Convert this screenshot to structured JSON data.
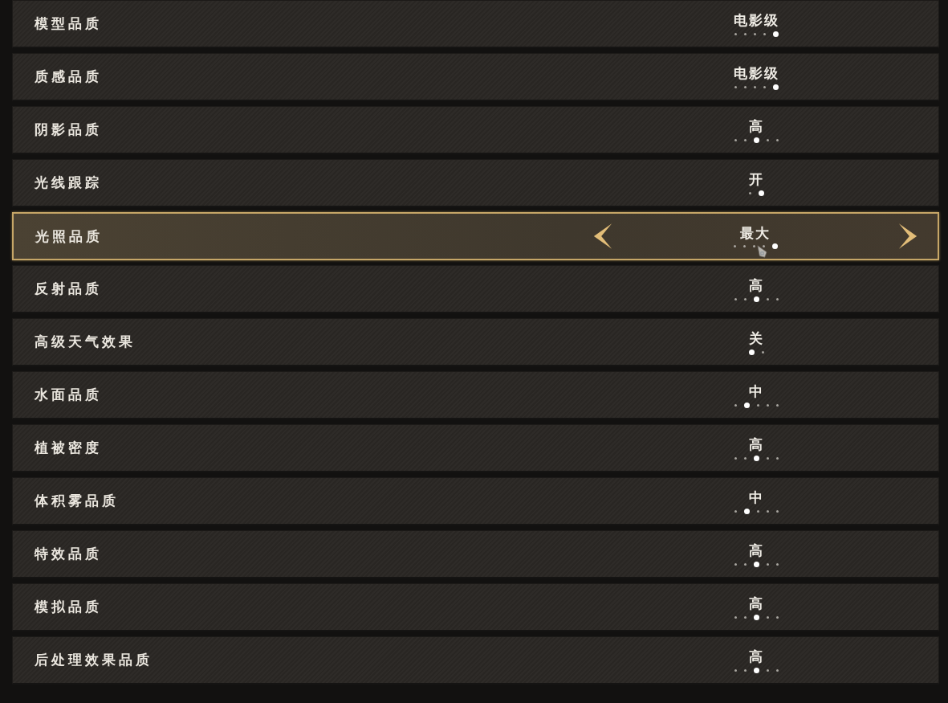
{
  "settings": [
    {
      "label": "模型品质",
      "value": "电影级",
      "selected": false,
      "steps": [
        {
          "selected": false
        },
        {
          "selected": false
        },
        {
          "selected": false
        },
        {
          "selected": false
        },
        {
          "selected": true
        }
      ]
    },
    {
      "label": "质感品质",
      "value": "电影级",
      "selected": false,
      "steps": [
        {
          "selected": false
        },
        {
          "selected": false
        },
        {
          "selected": false
        },
        {
          "selected": false
        },
        {
          "selected": true
        }
      ]
    },
    {
      "label": "阴影品质",
      "value": "高",
      "selected": false,
      "steps": [
        {
          "selected": false
        },
        {
          "selected": false
        },
        {
          "selected": true
        },
        {
          "selected": false
        },
        {
          "selected": false
        }
      ]
    },
    {
      "label": "光线跟踪",
      "value": "开",
      "selected": false,
      "steps": [
        {
          "selected": false
        },
        {
          "selected": true
        }
      ]
    },
    {
      "label": "光照品质",
      "value": "最大",
      "selected": true,
      "steps": [
        {
          "selected": false
        },
        {
          "selected": false
        },
        {
          "selected": false
        },
        {
          "selected": false
        },
        {
          "selected": true
        }
      ]
    },
    {
      "label": "反射品质",
      "value": "高",
      "selected": false,
      "steps": [
        {
          "selected": false
        },
        {
          "selected": false
        },
        {
          "selected": true
        },
        {
          "selected": false
        },
        {
          "selected": false
        }
      ]
    },
    {
      "label": "高级天气效果",
      "value": "关",
      "selected": false,
      "steps": [
        {
          "selected": true
        },
        {
          "selected": false
        }
      ]
    },
    {
      "label": "水面品质",
      "value": "中",
      "selected": false,
      "steps": [
        {
          "selected": false
        },
        {
          "selected": true
        },
        {
          "selected": false
        },
        {
          "selected": false
        },
        {
          "selected": false
        }
      ]
    },
    {
      "label": "植被密度",
      "value": "高",
      "selected": false,
      "steps": [
        {
          "selected": false
        },
        {
          "selected": false
        },
        {
          "selected": true
        },
        {
          "selected": false
        },
        {
          "selected": false
        }
      ]
    },
    {
      "label": "体积雾品质",
      "value": "中",
      "selected": false,
      "steps": [
        {
          "selected": false
        },
        {
          "selected": true
        },
        {
          "selected": false
        },
        {
          "selected": false
        },
        {
          "selected": false
        }
      ]
    },
    {
      "label": "特效品质",
      "value": "高",
      "selected": false,
      "steps": [
        {
          "selected": false
        },
        {
          "selected": false
        },
        {
          "selected": true
        },
        {
          "selected": false
        },
        {
          "selected": false
        }
      ]
    },
    {
      "label": "模拟品质",
      "value": "高",
      "selected": false,
      "steps": [
        {
          "selected": false
        },
        {
          "selected": false
        },
        {
          "selected": true
        },
        {
          "selected": false
        },
        {
          "selected": false
        }
      ]
    },
    {
      "label": "后处理效果品质",
      "value": "高",
      "selected": false,
      "steps": [
        {
          "selected": false
        },
        {
          "selected": false
        },
        {
          "selected": true
        },
        {
          "selected": false
        },
        {
          "selected": false
        }
      ]
    }
  ]
}
